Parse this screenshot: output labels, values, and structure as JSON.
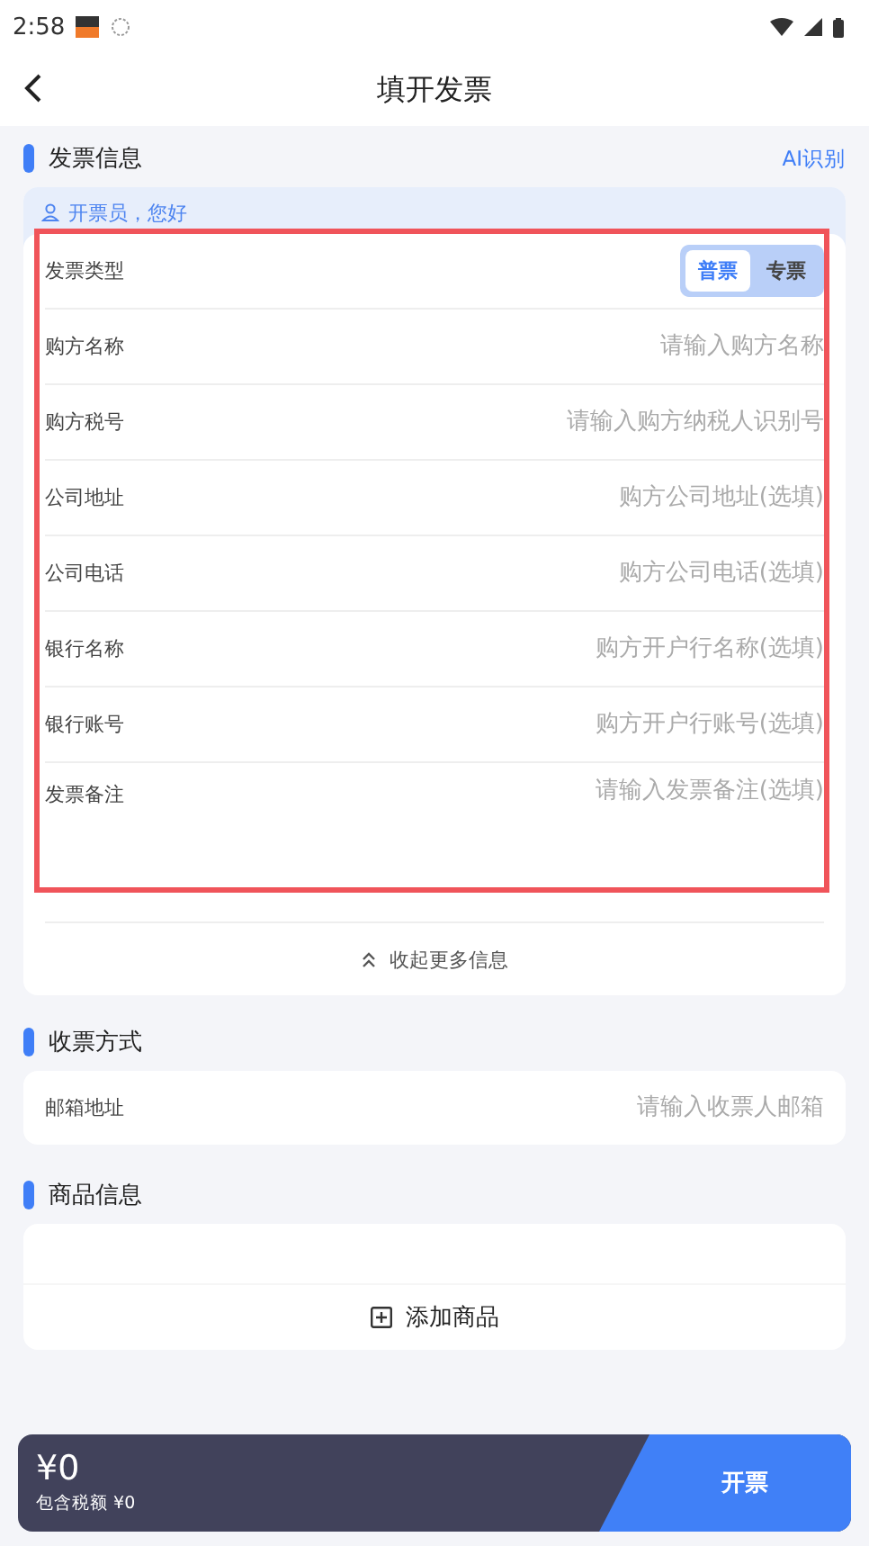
{
  "status_bar": {
    "time": "2:58"
  },
  "header": {
    "title": "填开发票"
  },
  "invoice_section": {
    "title": "发票信息",
    "action": "AI识别",
    "greeting": "开票员，您好",
    "type_row": {
      "label": "发票类型",
      "options": [
        {
          "label": "普票",
          "selected": true
        },
        {
          "label": "专票",
          "selected": false
        }
      ]
    },
    "fields": [
      {
        "label": "购方名称",
        "placeholder": "请输入购方名称"
      },
      {
        "label": "购方税号",
        "placeholder": "请输入购方纳税人识别号"
      },
      {
        "label": "公司地址",
        "placeholder": "购方公司地址(选填)"
      },
      {
        "label": "公司电话",
        "placeholder": "购方公司电话(选填)"
      },
      {
        "label": "银行名称",
        "placeholder": "购方开户行名称(选填)"
      },
      {
        "label": "银行账号",
        "placeholder": "购方开户行账号(选填)"
      },
      {
        "label": "发票备注",
        "placeholder": "请输入发票备注(选填)",
        "kind": "multiline"
      }
    ],
    "collapse": "收起更多信息"
  },
  "delivery_section": {
    "title": "收票方式",
    "fields": [
      {
        "label": "邮箱地址",
        "placeholder": "请输入收票人邮箱"
      }
    ]
  },
  "goods_section": {
    "title": "商品信息",
    "add": "添加商品"
  },
  "footer": {
    "total": "¥0",
    "tax": "包含税额 ¥0",
    "submit": "开票"
  }
}
